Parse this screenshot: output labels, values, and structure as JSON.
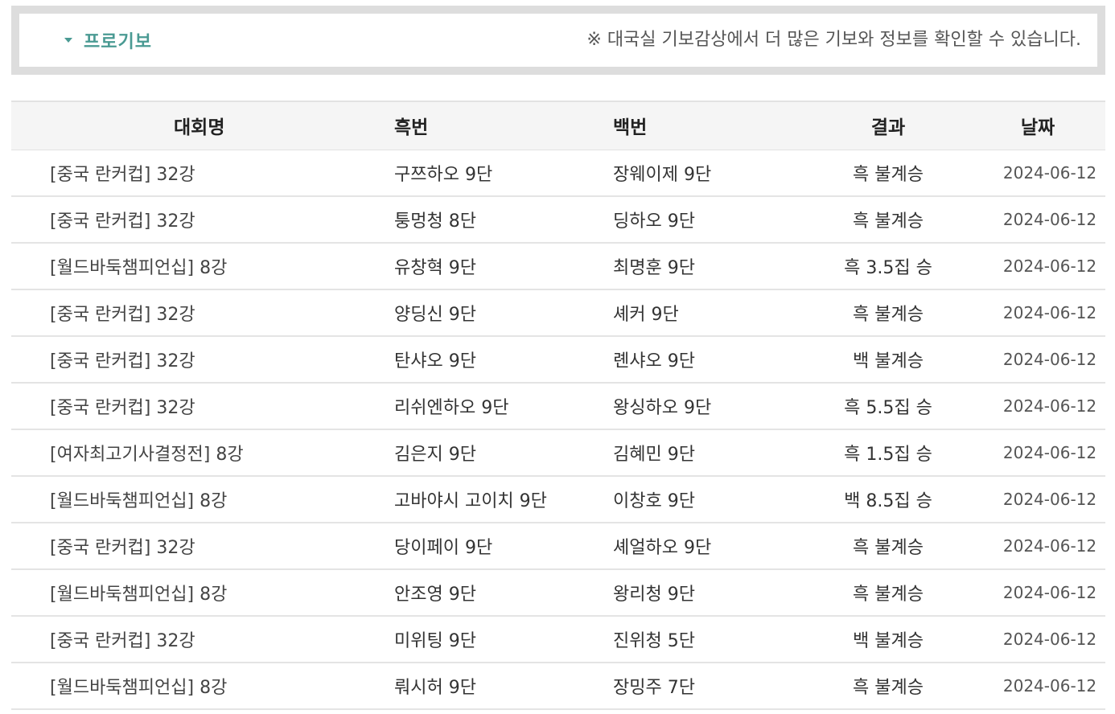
{
  "notice": {
    "title": "프로기보",
    "message": "※ 대국실 기보감상에서 더 많은 기보와 정보를 확인할 수 있습니다.",
    "accent_color": "#4a9a93",
    "icon": "triangle-down-icon"
  },
  "table": {
    "headers": {
      "tournament": "대회명",
      "black": "흑번",
      "white": "백번",
      "result": "결과",
      "date": "날짜"
    },
    "rows": [
      {
        "tournament": "[중국 란커컵] 32강",
        "black": "구쯔하오 9단",
        "white": "장웨이제 9단",
        "result": "흑 불계승",
        "date": "2024-06-12"
      },
      {
        "tournament": "[중국 란커컵] 32강",
        "black": "퉁멍청 8단",
        "white": "딩하오 9단",
        "result": "흑 불계승",
        "date": "2024-06-12"
      },
      {
        "tournament": "[월드바둑챔피언십] 8강",
        "black": "유창혁 9단",
        "white": "최명훈 9단",
        "result": "흑 3.5집 승",
        "date": "2024-06-12"
      },
      {
        "tournament": "[중국 란커컵] 32강",
        "black": "양딩신 9단",
        "white": "셰커 9단",
        "result": "흑 불계승",
        "date": "2024-06-12"
      },
      {
        "tournament": "[중국 란커컵] 32강",
        "black": "탄샤오 9단",
        "white": "롄샤오 9단",
        "result": "백 불계승",
        "date": "2024-06-12"
      },
      {
        "tournament": "[중국 란커컵] 32강",
        "black": "리쉬엔하오 9단",
        "white": "왕싱하오 9단",
        "result": "흑 5.5집 승",
        "date": "2024-06-12"
      },
      {
        "tournament": "[여자최고기사결정전] 8강",
        "black": "김은지 9단",
        "white": "김혜민 9단",
        "result": "흑 1.5집 승",
        "date": "2024-06-12"
      },
      {
        "tournament": "[월드바둑챔피언십] 8강",
        "black": "고바야시 고이치 9단",
        "white": "이창호 9단",
        "result": "백 8.5집 승",
        "date": "2024-06-12"
      },
      {
        "tournament": "[중국 란커컵] 32강",
        "black": "당이페이 9단",
        "white": "셰얼하오 9단",
        "result": "흑 불계승",
        "date": "2024-06-12"
      },
      {
        "tournament": "[월드바둑챔피언십] 8강",
        "black": "안조영 9단",
        "white": "왕리청 9단",
        "result": "흑 불계승",
        "date": "2024-06-12"
      },
      {
        "tournament": "[중국 란커컵] 32강",
        "black": "미위팅 9단",
        "white": "진위청 5단",
        "result": "백 불계승",
        "date": "2024-06-12"
      },
      {
        "tournament": "[월드바둑챔피언십] 8강",
        "black": "뤄시허 9단",
        "white": "장밍주 7단",
        "result": "흑 불계승",
        "date": "2024-06-12"
      }
    ]
  }
}
